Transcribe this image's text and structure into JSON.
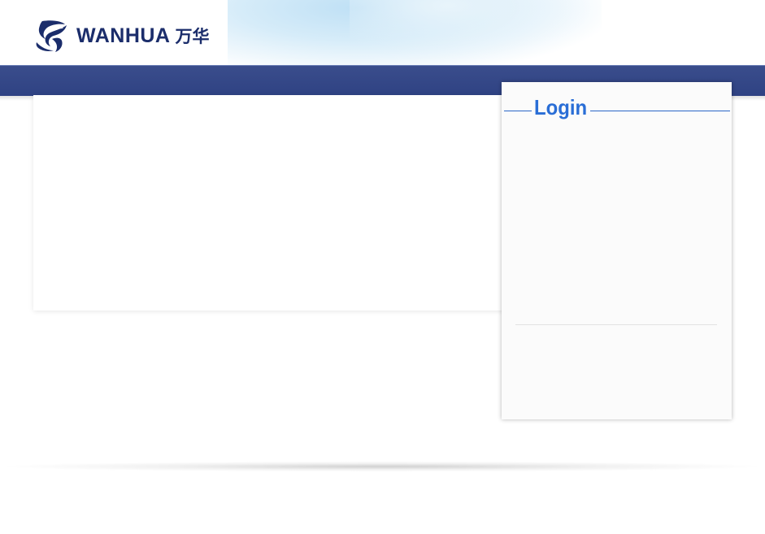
{
  "header": {
    "logo_text": "WANHUA",
    "logo_cn": "万华",
    "logo_icon": "wanhua-swirl-logo"
  },
  "login": {
    "title": "Login"
  },
  "colors": {
    "band": "#33468a",
    "logo": "#1b2d6b",
    "login_accent": "#2a6ed6"
  }
}
